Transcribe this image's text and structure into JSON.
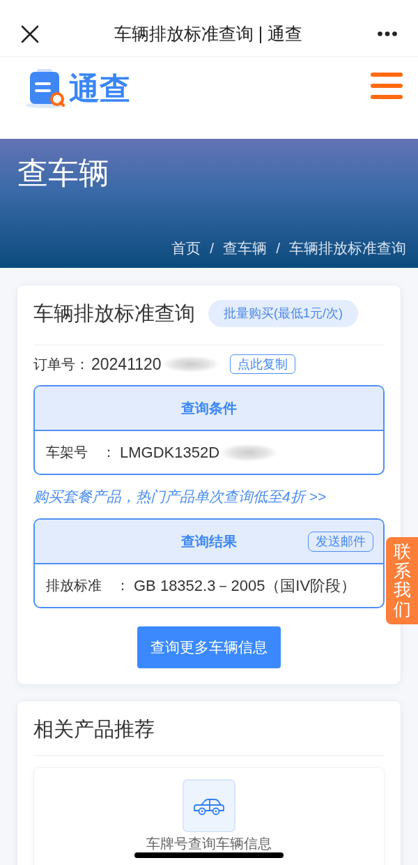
{
  "nav_bar": {
    "title": "车辆排放标准查询 | 通查"
  },
  "header": {
    "logo_text": "通查"
  },
  "banner": {
    "title": "查车辆",
    "breadcrumb": [
      {
        "label": "首页",
        "separator": "/"
      },
      {
        "label": "查车辆",
        "separator": "/"
      },
      {
        "label": "车辆排放标准查询"
      }
    ]
  },
  "query_card": {
    "title": "车辆排放标准查询",
    "bulk_buy_button": "批量购买(最低1元/次)",
    "order": {
      "label": "订单号：",
      "value": "20241120",
      "redacted": true
    },
    "copy_button": "点此复制",
    "conditions": {
      "title": "查询条件",
      "rows": [
        {
          "label": "车架号　：",
          "value": "LMGDK1352D",
          "redacted": true
        }
      ]
    },
    "promo_link": "购买套餐产品，热门产品单次查询低至4折 >>",
    "results": {
      "title": "查询结果",
      "action_button": "发送邮件",
      "rows": [
        {
          "label": "排放标准　：",
          "value": "GB 18352.3－2005（国IV阶段）",
          "redacted": false
        }
      ]
    },
    "more_button": "查询更多车辆信息"
  },
  "recommend_card": {
    "title": "相关产品推荐",
    "products": [
      {
        "name": "车牌号查询车辆信息"
      }
    ]
  },
  "contact_tab": {
    "label": "联系我们"
  }
}
